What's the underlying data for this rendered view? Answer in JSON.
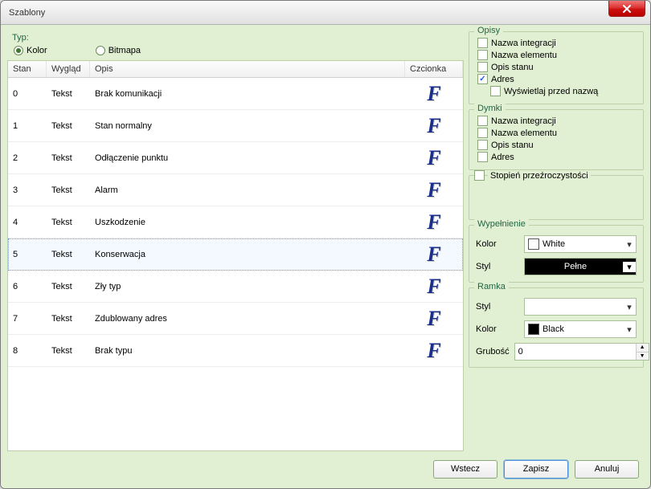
{
  "window": {
    "title": "Szablony"
  },
  "typ": {
    "label": "Typ:",
    "opt_kolor": "Kolor",
    "opt_bitmapa": "Bitmapa",
    "selected": "Kolor"
  },
  "table": {
    "headers": {
      "stan": "Stan",
      "wyglad": "Wygląd",
      "opis": "Opis",
      "czcionka": "Czcionka"
    },
    "selected_index": 5,
    "rows": [
      {
        "stan": "0",
        "wyglad": "Tekst",
        "opis": "Brak komunikacji"
      },
      {
        "stan": "1",
        "wyglad": "Tekst",
        "opis": "Stan normalny"
      },
      {
        "stan": "2",
        "wyglad": "Tekst",
        "opis": "Odłączenie punktu"
      },
      {
        "stan": "3",
        "wyglad": "Tekst",
        "opis": "Alarm"
      },
      {
        "stan": "4",
        "wyglad": "Tekst",
        "opis": "Uszkodzenie"
      },
      {
        "stan": "5",
        "wyglad": "Tekst",
        "opis": "Konserwacja"
      },
      {
        "stan": "6",
        "wyglad": "Tekst",
        "opis": "Zły typ"
      },
      {
        "stan": "7",
        "wyglad": "Tekst",
        "opis": "Zdublowany adres"
      },
      {
        "stan": "8",
        "wyglad": "Tekst",
        "opis": "Brak typu"
      }
    ]
  },
  "opisy": {
    "legend": "Opisy",
    "items": [
      {
        "key": "nazwa_integracji",
        "label": "Nazwa integracji",
        "checked": false
      },
      {
        "key": "nazwa_elementu",
        "label": "Nazwa elementu",
        "checked": false
      },
      {
        "key": "opis_stanu",
        "label": "Opis stanu",
        "checked": false
      },
      {
        "key": "adres",
        "label": "Adres",
        "checked": true
      },
      {
        "key": "wyswietlaj_przed_nazwa",
        "label": "Wyświetlaj przed nazwą",
        "checked": false,
        "indent": true
      }
    ]
  },
  "dymki": {
    "legend": "Dymki",
    "items": [
      {
        "key": "nazwa_integracji",
        "label": "Nazwa integracji",
        "checked": false
      },
      {
        "key": "nazwa_elementu",
        "label": "Nazwa elementu",
        "checked": false
      },
      {
        "key": "opis_stanu",
        "label": "Opis stanu",
        "checked": false
      },
      {
        "key": "adres",
        "label": "Adres",
        "checked": false
      }
    ]
  },
  "przezroczystosc": {
    "label": "Stopień przeźroczystości",
    "checked": false
  },
  "wypelnienie": {
    "legend": "Wypełnienie",
    "kolor_label": "Kolor",
    "kolor_value": "White",
    "kolor_swatch": "#ffffff",
    "styl_label": "Styl",
    "styl_value": "Pełne"
  },
  "ramka": {
    "legend": "Ramka",
    "styl_label": "Styl",
    "styl_value": "",
    "kolor_label": "Kolor",
    "kolor_value": "Black",
    "kolor_swatch": "#000000",
    "grubosc_label": "Grubość",
    "grubosc_value": "0"
  },
  "buttons": {
    "back": "Wstecz",
    "save": "Zapisz",
    "cancel": "Anuluj"
  }
}
